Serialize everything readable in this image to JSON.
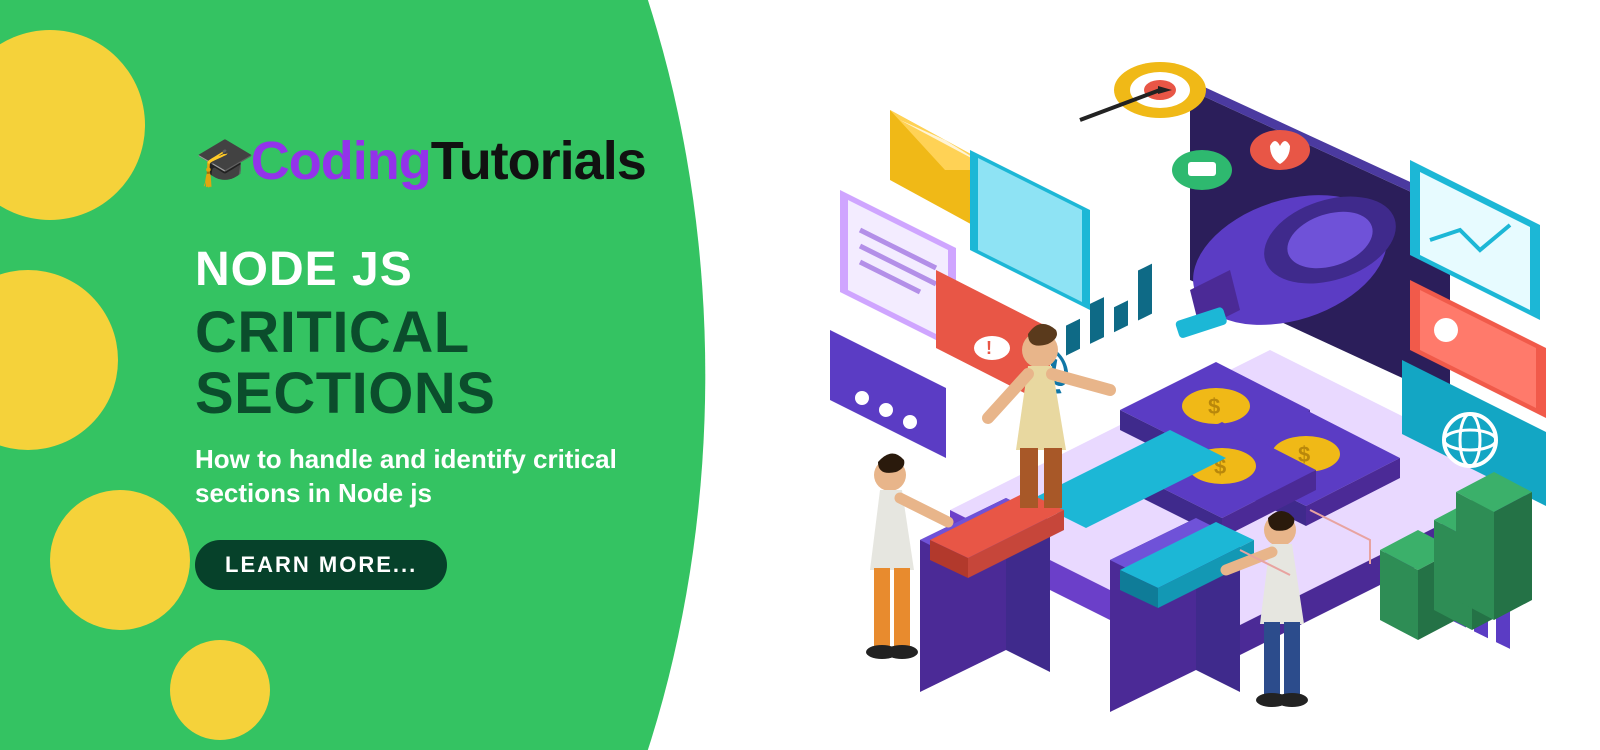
{
  "logo": {
    "part1": "Coding",
    "part2": "Tutorials"
  },
  "hero": {
    "topic": "NODE JS",
    "headline_line1": "CRITICAL",
    "headline_line2": "SECTIONS",
    "subtitle": "How to handle and identify critical sections in Node js",
    "cta": "LEARN MORE..."
  },
  "colors": {
    "brand_green": "#34C362",
    "brand_yellow": "#F5D23A",
    "brand_purple": "#9333EA",
    "dark_green": "#0B4D2C",
    "cta_bg": "#06412A"
  }
}
